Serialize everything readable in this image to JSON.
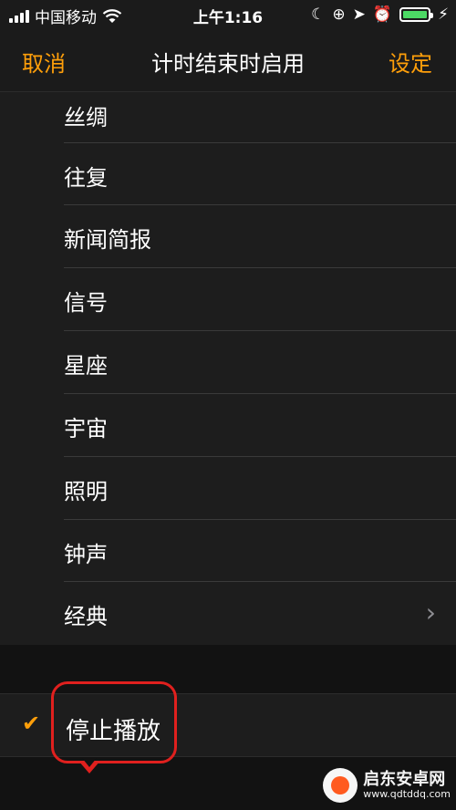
{
  "status_bar": {
    "carrier": "中国移动",
    "time": "上午1:16",
    "battery_level": 0.95,
    "icons": [
      "signal-icon",
      "wifi-icon",
      "moon-icon",
      "rotation-lock-icon",
      "location-icon",
      "alarm-icon",
      "battery-icon",
      "charging-icon"
    ]
  },
  "nav": {
    "cancel_label": "取消",
    "title": "计时结束时启用",
    "set_label": "设定"
  },
  "list": {
    "items": [
      {
        "label": "丝绸"
      },
      {
        "label": "往复"
      },
      {
        "label": "新闻简报"
      },
      {
        "label": "信号"
      },
      {
        "label": "星座"
      },
      {
        "label": "宇宙"
      },
      {
        "label": "照明"
      },
      {
        "label": "钟声"
      },
      {
        "label": "经典",
        "has_chevron": true
      }
    ]
  },
  "stop_option": {
    "label": "停止播放",
    "selected": true
  },
  "watermark": {
    "name": "启东安卓网",
    "url": "www.qdtddq.com"
  },
  "colors": {
    "accent": "#ff9f0a",
    "highlight": "#e0201e",
    "battery": "#4cd964"
  }
}
